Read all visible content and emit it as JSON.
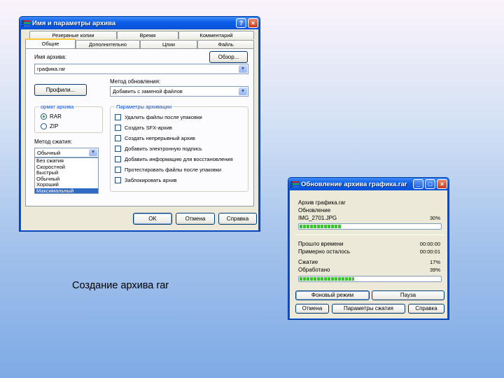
{
  "caption": "Создание архива rar",
  "archive_dialog": {
    "title": "Имя и параметры архива",
    "tabs_back": [
      "Резервные копии",
      "Время",
      "Комментарий"
    ],
    "tabs_front": [
      "Общие",
      "Дополнительно",
      "Цпии",
      "Файль"
    ],
    "archive_name_label": "Имя архива:",
    "archive_name_value": "графика.rar",
    "browse_button": "Обзор...",
    "update_method_label": "Метод обновления:",
    "update_method_value": "Добавить с заменой файлов",
    "profiles_button": "Профили...",
    "format_group_label": "ормат архива",
    "format_options": [
      {
        "label": "RAR",
        "checked": true
      },
      {
        "label": "ZIP",
        "checked": false
      }
    ],
    "compression_label": "Метод сжатия:",
    "compression_value": "Обычный",
    "compression_options": [
      "Без сжатия",
      "Скоростной",
      "Быстрый",
      "Обычный",
      "Хороший",
      "Максимальный"
    ],
    "compression_selected": "Максимальный",
    "options_group_label": "Параметры архивации",
    "options": [
      "Удалить файлы после упаковки",
      "Создать SFX-архив",
      "Создать непрерывный архив",
      "Добавить электронную подпись",
      "Добавить информацию для восстановления",
      "Протестировать файлы после упаковки",
      "Заблокировать архив"
    ],
    "ok_button": "OK",
    "cancel_button": "Отмена",
    "help_button": "Справка",
    "window_controls": [
      "?",
      "×"
    ]
  },
  "progress_dialog": {
    "title": "Обновление архива графика.rar",
    "archive_line": "Архив графика.rar",
    "action_line": "Обновление",
    "file_name": "IMG_2701.JPG",
    "file_percent": "30%",
    "file_progress": 0.3,
    "elapsed_label": "Прошло времени",
    "elapsed_value": "00:00:00",
    "remaining_label": "Примерно осталось",
    "remaining_value": "00:00:01",
    "ratio_label": "Сжатие",
    "ratio_value": "17%",
    "processed_label": "Обработано",
    "processed_value": "39%",
    "total_progress": 0.39,
    "background_button": "Фоновый режим",
    "pause_button": "Пауза",
    "cancel_button": "Отмена",
    "params_button": "Параметры сжатия",
    "help_button": "Справка",
    "window_controls": [
      "_",
      "□",
      "×"
    ]
  }
}
